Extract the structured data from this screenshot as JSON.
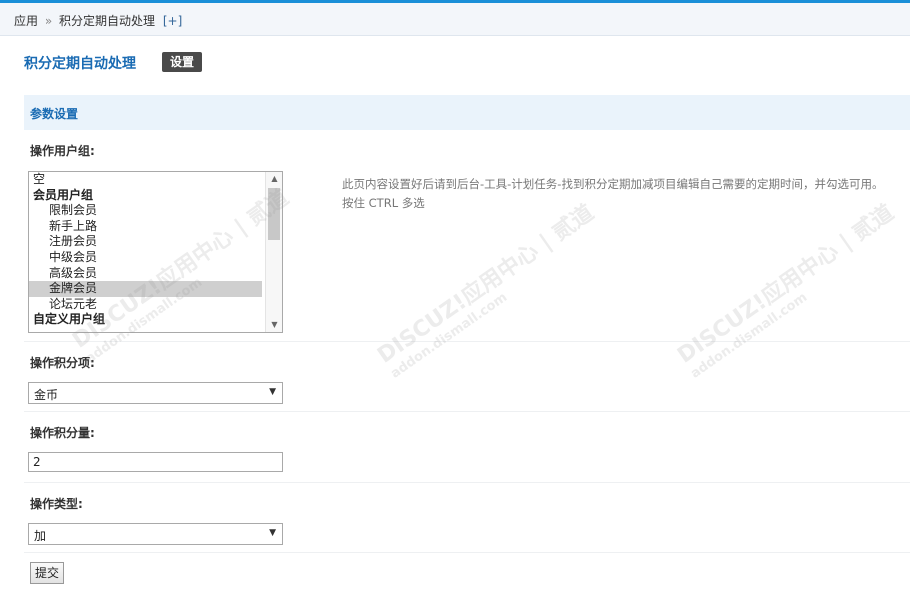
{
  "breadcrumb": {
    "root": "应用",
    "separator": "»",
    "current": "积分定期自动处理",
    "add": "[+]"
  },
  "header": {
    "title": "积分定期自动处理",
    "settings_label": "设置"
  },
  "section": {
    "title": "参数设置"
  },
  "form": {
    "usergroup": {
      "label": "操作用户组:",
      "options": [
        {
          "text": "空",
          "kind": "plain"
        },
        {
          "text": "会员用户组",
          "kind": "group"
        },
        {
          "text": "限制会员",
          "kind": "child"
        },
        {
          "text": "新手上路",
          "kind": "child"
        },
        {
          "text": "注册会员",
          "kind": "child"
        },
        {
          "text": "中级会员",
          "kind": "child"
        },
        {
          "text": "高级会员",
          "kind": "child"
        },
        {
          "text": "金牌会员",
          "kind": "child",
          "selected": true
        },
        {
          "text": "论坛元老",
          "kind": "child"
        },
        {
          "text": "自定义用户组",
          "kind": "group"
        }
      ],
      "tip_line1": "此页内容设置好后请到后台-工具-计划任务-找到积分定期加减项目编辑自己需要的定期时间，并勾选可用。",
      "tip_line2": "按住 CTRL 多选"
    },
    "credit_item": {
      "label": "操作积分项:",
      "value": "金币"
    },
    "credit_amount": {
      "label": "操作积分量:",
      "value": "2"
    },
    "op_type": {
      "label": "操作类型:",
      "value": "加"
    },
    "submit_label": "提交"
  },
  "watermark": {
    "brand": "DISCUZ!应用中心 | 贰道",
    "domain": "addon.dismall.com"
  },
  "colors": {
    "accent": "#1a8fd8",
    "title": "#1a6bb3",
    "section_bg": "#eaf3fb"
  }
}
